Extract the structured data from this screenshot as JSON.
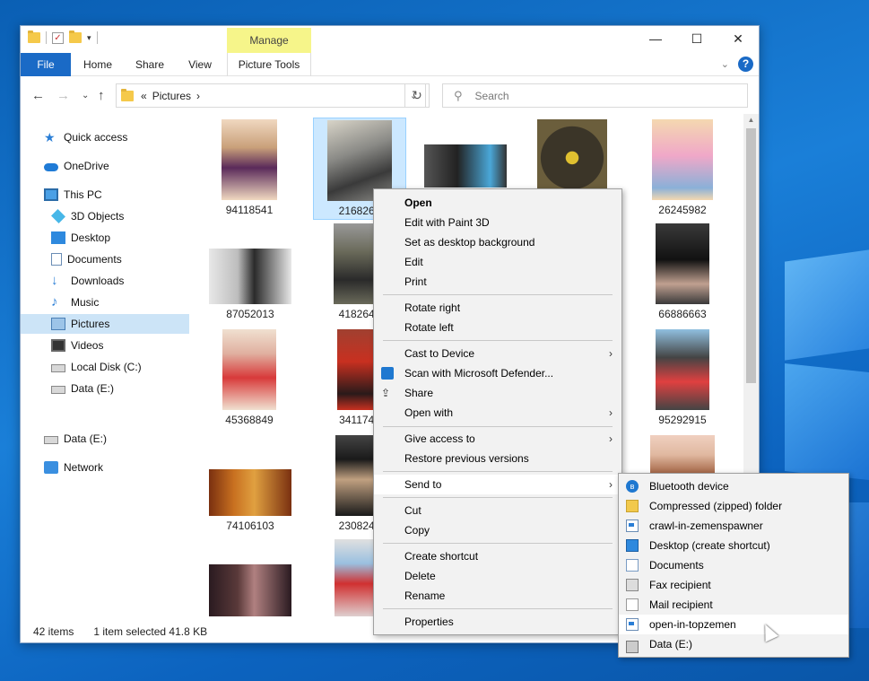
{
  "window": {
    "manage_tab": "Manage",
    "controls": {
      "minimize": "—",
      "maximize": "☐",
      "close": "✕"
    }
  },
  "ribbon": {
    "tabs": [
      "File",
      "Home",
      "Share",
      "View",
      "Picture Tools"
    ]
  },
  "address": {
    "prefix": "«",
    "location": "Pictures",
    "separator": "›",
    "search_placeholder": "Search"
  },
  "sidebar": {
    "items": [
      {
        "label": "Quick access",
        "icon": "star-icon"
      },
      {
        "label": "OneDrive",
        "icon": "cloud-icon"
      },
      {
        "label": "This PC",
        "icon": "computer-icon"
      },
      {
        "label": "3D Objects",
        "icon": "cube-icon"
      },
      {
        "label": "Desktop",
        "icon": "desktop-icon"
      },
      {
        "label": "Documents",
        "icon": "documents-icon"
      },
      {
        "label": "Downloads",
        "icon": "download-icon"
      },
      {
        "label": "Music",
        "icon": "music-icon"
      },
      {
        "label": "Pictures",
        "icon": "pictures-icon",
        "selected": true
      },
      {
        "label": "Videos",
        "icon": "videos-icon"
      },
      {
        "label": "Local Disk (C:)",
        "icon": "disk-icon"
      },
      {
        "label": "Data (E:)",
        "icon": "drive-icon"
      },
      {
        "label": "Data (E:)",
        "icon": "drive-icon"
      },
      {
        "label": "Network",
        "icon": "network-icon"
      }
    ]
  },
  "files": [
    {
      "name": "94118541",
      "colors": [
        "#c9a07a",
        "#5a2a5a",
        "#f0d8c0"
      ]
    },
    {
      "name": "2168265",
      "colors": [
        "#8a8a86",
        "#3a3a3a",
        "#d8d4c8"
      ],
      "selected": true
    },
    {
      "name": "",
      "colors": [
        "#555",
        "#222",
        "#4aa7d8"
      ]
    },
    {
      "name": "",
      "colors": [
        "#3b3528",
        "#e0c030",
        "#6b5e3c"
      ]
    },
    {
      "name": "26245982",
      "colors": [
        "#f0a8c8",
        "#8ab0d8",
        "#f4d8b0"
      ]
    },
    {
      "name": "87052013",
      "colors": [
        "#e8e8e8",
        "#2a2a2a",
        "#bdbdbd"
      ]
    },
    {
      "name": "4182645",
      "colors": [
        "#6a6a5a",
        "#2a2a2a",
        "#999"
      ]
    },
    {
      "name": "66886663",
      "colors": [
        "#3a3a3a",
        "#111",
        "#c0a090"
      ]
    },
    {
      "name": "45368849",
      "colors": [
        "#e0b0a0",
        "#d83a3a",
        "#f0e0d0"
      ]
    },
    {
      "name": "3411747",
      "colors": [
        "#c83020",
        "#2a1a1a",
        "#a04030"
      ]
    },
    {
      "name": "95292915",
      "colors": [
        "#444",
        "#e04040",
        "#90c0e0"
      ]
    },
    {
      "name": "74106103",
      "colors": [
        "#c87020",
        "#e0a040",
        "#7a3010"
      ]
    },
    {
      "name": "2308245",
      "colors": [
        "#1a1a1a",
        "#c0a080",
        "#444"
      ]
    },
    {
      "name": "",
      "colors": [
        "#2a1a20",
        "#b08080",
        "#5a3a3a"
      ]
    },
    {
      "name": "",
      "colors": [
        "#e0e0e0",
        "#d03030",
        "#9ac0e0"
      ]
    },
    {
      "name": "",
      "colors": [
        "#e0b8a0",
        "#a06040",
        "#f0d0c0"
      ]
    }
  ],
  "status": {
    "count": "42 items",
    "selection": "1 item selected  41.8 KB"
  },
  "context_menu": {
    "groups": [
      [
        "Open",
        "Edit with Paint 3D",
        "Set as desktop background",
        "Edit",
        "Print"
      ],
      [
        "Rotate right",
        "Rotate left"
      ],
      [
        "Cast to Device",
        "Scan with Microsoft Defender...",
        "Share",
        "Open with"
      ],
      [
        "Give access to",
        "Restore previous versions"
      ],
      [
        "Send to"
      ],
      [
        "Cut",
        "Copy"
      ],
      [
        "Create shortcut",
        "Delete",
        "Rename"
      ],
      [
        "Properties"
      ]
    ]
  },
  "send_to": {
    "items": [
      {
        "label": "Bluetooth device",
        "icon": "bluetooth-icon"
      },
      {
        "label": "Compressed (zipped) folder",
        "icon": "zip-folder-icon"
      },
      {
        "label": "crawl-in-zemenspawner",
        "icon": "app-shortcut-icon"
      },
      {
        "label": "Desktop (create shortcut)",
        "icon": "desktop-icon"
      },
      {
        "label": "Documents",
        "icon": "documents-icon"
      },
      {
        "label": "Fax recipient",
        "icon": "fax-icon"
      },
      {
        "label": "Mail recipient",
        "icon": "mail-icon"
      },
      {
        "label": "open-in-topzemen",
        "icon": "app-shortcut-icon",
        "highlighted": true
      },
      {
        "label": "Data (E:)",
        "icon": "drive-icon"
      }
    ]
  }
}
